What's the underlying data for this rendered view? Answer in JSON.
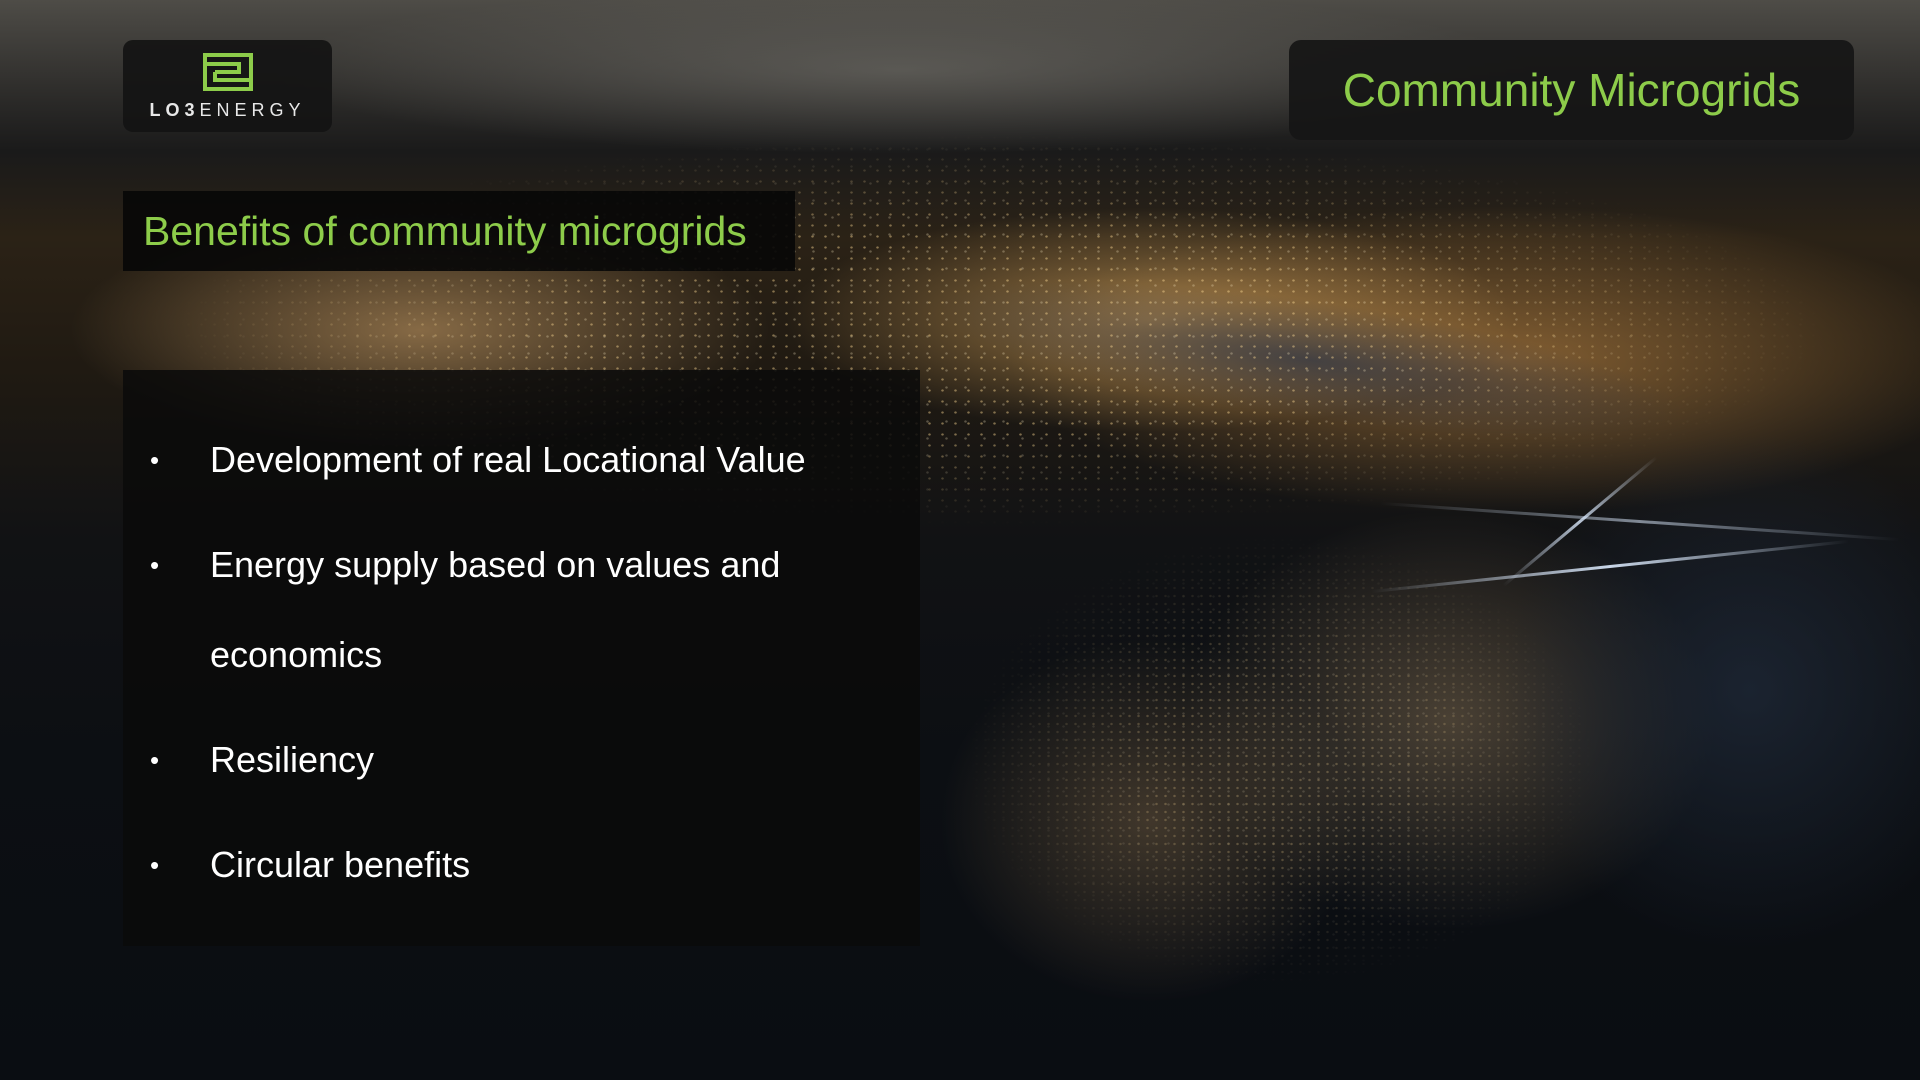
{
  "logo": {
    "word_bold": "LO3",
    "word_rest": "ENERGY",
    "icon": "lo3-logo-mark",
    "icon_color": "#8dcc4a"
  },
  "slide": {
    "title": "Community Microgrids",
    "subtitle": "Benefits of community microgrids",
    "accent_color": "#8dcc4a",
    "bullets": [
      {
        "lines": [
          "Development of real Locational Value"
        ]
      },
      {
        "lines": [
          "Energy supply based on values and",
          "economics"
        ]
      },
      {
        "lines": [
          "Resiliency"
        ]
      },
      {
        "lines": [
          "Circular benefits"
        ]
      }
    ],
    "bullet_glyph": "•"
  }
}
